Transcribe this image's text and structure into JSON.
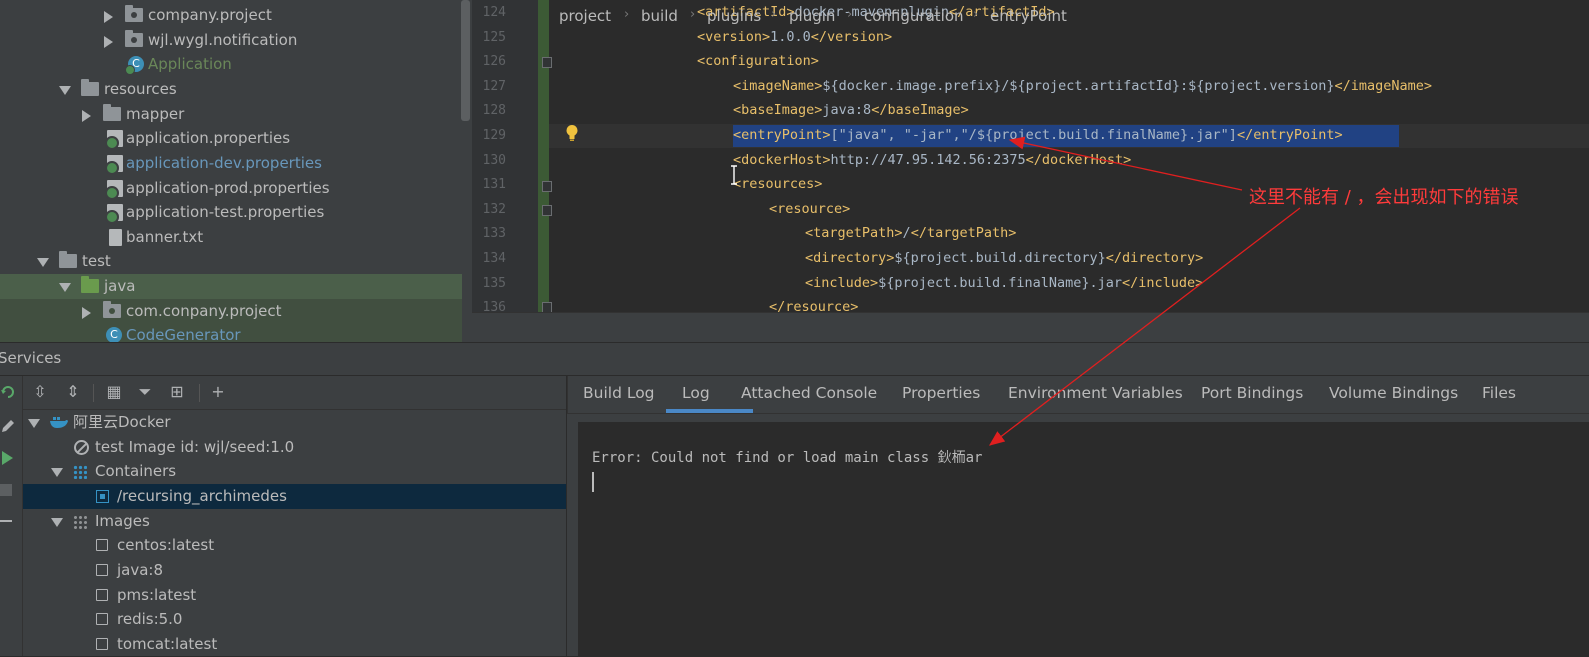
{
  "project_tree": {
    "items": [
      {
        "label": "company.project",
        "icon": "package-icon"
      },
      {
        "label": "wjl.wygl.notification",
        "icon": "package-icon"
      },
      {
        "label": "Application",
        "icon": "spring-class-icon"
      },
      {
        "label": "resources",
        "icon": "resources-folder-icon"
      },
      {
        "label": "mapper",
        "icon": "folder-icon"
      },
      {
        "label": "application.properties",
        "icon": "properties-file-icon"
      },
      {
        "label": "application-dev.properties",
        "icon": "properties-file-icon"
      },
      {
        "label": "application-prod.properties",
        "icon": "properties-file-icon"
      },
      {
        "label": "application-test.properties",
        "icon": "properties-file-icon"
      },
      {
        "label": "banner.txt",
        "icon": "text-file-icon"
      },
      {
        "label": "test",
        "icon": "folder-icon"
      },
      {
        "label": "java",
        "icon": "source-folder-icon"
      },
      {
        "label": "com.conpany.project",
        "icon": "package-icon"
      },
      {
        "label": "CodeGenerator",
        "icon": "class-icon"
      }
    ]
  },
  "editor": {
    "lines": [
      {
        "num": "124",
        "text": "<artifactId>docker-maven-plugin</artifactId>"
      },
      {
        "num": "125",
        "text": "<version>1.0.0</version>"
      },
      {
        "num": "126",
        "text": "<configuration>"
      },
      {
        "num": "127",
        "text": "<imageName>${docker.image.prefix}/${project.artifactId}:${project.version}</imageName>"
      },
      {
        "num": "128",
        "text": "<baseImage>java:8</baseImage>"
      },
      {
        "num": "129",
        "text": "<entryPoint>[\"java\", \"-jar\",\"/${project.build.finalName}.jar\"]</entryPoint>"
      },
      {
        "num": "130",
        "text": "<dockerHost>http://47.95.142.56:2375</dockerHost>"
      },
      {
        "num": "131",
        "text": "<resources>"
      },
      {
        "num": "132",
        "text": "<resource>"
      },
      {
        "num": "133",
        "text": "<targetPath>/</targetPath>"
      },
      {
        "num": "134",
        "text": "<directory>${project.build.directory}</directory>"
      },
      {
        "num": "135",
        "text": "<include>${project.build.finalName}.jar</include>"
      },
      {
        "num": "136",
        "text": "</resource>"
      }
    ],
    "annotation": "这里不能有 / ，会出现如下的错误"
  },
  "breadcrumb": [
    "project",
    "build",
    "plugins",
    "plugin",
    "configuration",
    "entryPoint"
  ],
  "services": {
    "title": "Services",
    "tree": [
      {
        "label": "阿里云Docker"
      },
      {
        "label": "test Image id: wjl/seed:1.0"
      },
      {
        "label": "Containers"
      },
      {
        "label": "/recursing_archimedes"
      },
      {
        "label": "Images"
      },
      {
        "label": "centos:latest"
      },
      {
        "label": "java:8"
      },
      {
        "label": "pms:latest"
      },
      {
        "label": "redis:5.0"
      },
      {
        "label": "tomcat:latest"
      }
    ],
    "tabs": [
      "Build Log",
      "Log",
      "Attached Console",
      "Properties",
      "Environment Variables",
      "Port Bindings",
      "Volume Bindings",
      "Files"
    ],
    "active_tab": "Log",
    "log_text": "Error: Could not find or load main class 鈥栭ar"
  },
  "colors": {
    "accent": "#4a88c7",
    "selection": "#214283",
    "annotation": "#ff3b3b",
    "xml_tag": "#e8bf6a"
  }
}
